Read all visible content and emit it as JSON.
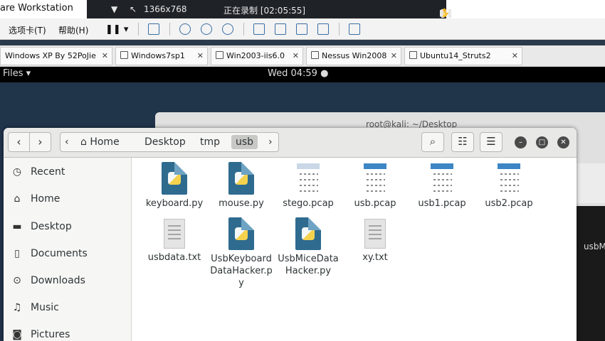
{
  "host": {
    "title": "are Workstation",
    "recording": {
      "resolution": "1366x768",
      "status": "正在录制 [02:05:55]"
    },
    "menu": {
      "tabs_menu": "选项卡(T)",
      "help_menu": "帮助(H)"
    },
    "vm_tabs": [
      {
        "label": "Windows XP By 52PoJie"
      },
      {
        "label": "Windows7sp1"
      },
      {
        "label": "Win2003-iis6.0"
      },
      {
        "label": "Nessus Win2008"
      },
      {
        "label": "Ubuntu14_Struts2"
      }
    ],
    "tab_close_glyph": "✕"
  },
  "guest": {
    "topbar": {
      "app_menu": "Files ▾",
      "clock": "Wed 04:59 ●"
    },
    "terminal": {
      "title": "root@kali: ~/Desktop",
      "side_text": "usbM"
    }
  },
  "files_window": {
    "breadcrumbs": [
      {
        "label": "Home"
      },
      {
        "label": "Desktop"
      },
      {
        "label": "tmp"
      },
      {
        "label": "usb"
      }
    ],
    "sidebar": [
      {
        "label": "Recent",
        "icon": "clock-icon"
      },
      {
        "label": "Home",
        "icon": "home-icon"
      },
      {
        "label": "Desktop",
        "icon": "folder-icon"
      },
      {
        "label": "Documents",
        "icon": "document-icon"
      },
      {
        "label": "Downloads",
        "icon": "download-icon"
      },
      {
        "label": "Music",
        "icon": "music-icon"
      },
      {
        "label": "Pictures",
        "icon": "camera-icon"
      }
    ],
    "files": [
      {
        "name": "keyboard.py",
        "type": "py"
      },
      {
        "name": "mouse.py",
        "type": "py"
      },
      {
        "name": "stego.pcap",
        "type": "pcap"
      },
      {
        "name": "usb.pcap",
        "type": "pcap"
      },
      {
        "name": "usb1.pcap",
        "type": "pcap"
      },
      {
        "name": "usb2.pcap",
        "type": "pcap"
      },
      {
        "name": "usbdata.txt",
        "type": "txt"
      },
      {
        "name": "UsbKeyboardDataHacker.py",
        "type": "py"
      },
      {
        "name": "UsbMiceDataHacker.py",
        "type": "py"
      },
      {
        "name": "xy.txt",
        "type": "txt"
      }
    ]
  }
}
